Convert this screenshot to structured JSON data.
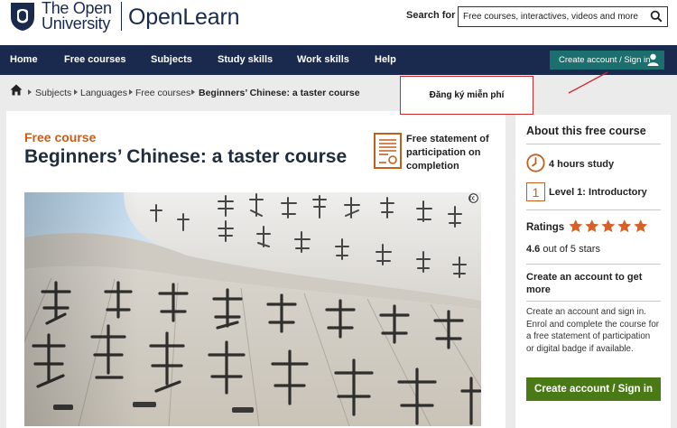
{
  "header": {
    "ou_logo_line1": "The Open",
    "ou_logo_line2": "University",
    "openlearn_logo": "OpenLearn",
    "search_label": "Search for",
    "search_placeholder": "Free courses, interactives, videos and more"
  },
  "nav": {
    "items": [
      "Home",
      "Free courses",
      "Subjects",
      "Study skills",
      "Work skills",
      "Help"
    ],
    "signin_label": "Create account / Sign in"
  },
  "breadcrumb": {
    "items": [
      "Subjects",
      "Languages",
      "Free courses"
    ],
    "current": "Beginners’ Chinese: a taster course"
  },
  "annotation": {
    "text": "Đăng ký miễn phí",
    "color": "#cc2a2a"
  },
  "course": {
    "type_label": "Free course",
    "title": "Beginners’ Chinese: a taster course",
    "cert_text": "Free statement of participation on completion"
  },
  "sidebar": {
    "about_title": "About this free course",
    "hours": "4 hours study",
    "level_number": "1",
    "level": "Level 1: Introductory",
    "ratings_label": "Ratings",
    "rating_value": "4.6",
    "rating_suffix": " out of 5 stars",
    "stars": 5,
    "create_title": "Create an account to get more",
    "create_text": "Create an account and sign in. Enrol and complete the course for a free statement of participation or digital badge if available.",
    "create_button": "Create account / Sign in"
  },
  "colors": {
    "navy": "#1a2a4e",
    "orange": "#c45e1b",
    "teal": "#1b6f6f",
    "green": "#4a7a16",
    "star": "#d4602a"
  }
}
